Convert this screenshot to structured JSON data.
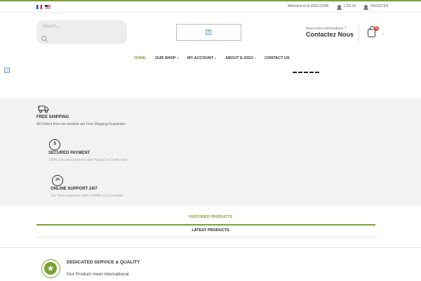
{
  "topbar": {
    "languages": [
      "French",
      "English"
    ],
    "welcome": "Welcome to E-ZIGO.COM",
    "login": "LOG IN",
    "register": "REGISTER"
  },
  "header": {
    "search_placeholder": "Search...",
    "info_question": "Need more informations ?",
    "info_contact": "Contactez Nous",
    "cart_count": "0"
  },
  "nav": {
    "items": [
      {
        "label": "HOME",
        "active": true
      },
      {
        "label": "OUR SHOP"
      },
      {
        "label": "MY ACCOUNT"
      },
      {
        "label": "ABOUT E-ZIGO"
      },
      {
        "label": "CONTACT US"
      }
    ]
  },
  "features": [
    {
      "title": "FREE SHIPPING",
      "text": "All Orders from our website are Free Shipping Guarantee",
      "icon": "truck-icon"
    },
    {
      "title": "SECURED PAYMENT",
      "text": "100% Secured payment with Paypal or Credit card",
      "icon": "dollar-icon",
      "icon_glyph": "$"
    },
    {
      "title": "ONLINE SUPPORT 24/7",
      "text": "Our Team answers within 24/48h to your email",
      "icon": "support-24-icon",
      "icon_glyph": "24"
    }
  ],
  "tabs": {
    "featured": "FEATURED PRODUCTS",
    "latest": "LATEST PRODUCTS"
  },
  "service": {
    "title": "DEDICATED SERVICE & QUALITY",
    "text": "Our Product meet international",
    "icon_glyph": "★"
  },
  "colors": {
    "accent": "#7aa232",
    "band": "#f2f2f2",
    "badge": "#e34e3e"
  }
}
